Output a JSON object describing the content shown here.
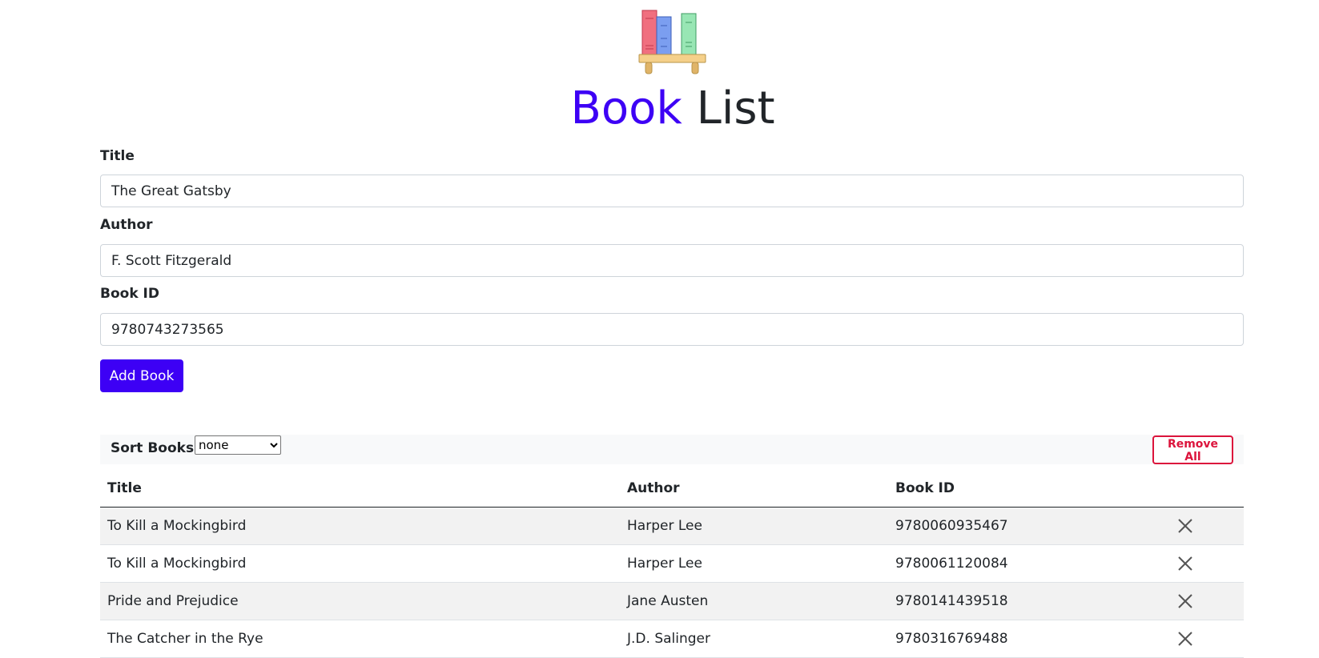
{
  "header": {
    "logo_icon": "bookshelf-icon",
    "title_accent": "Book",
    "title_rest": "List",
    "accent_color": "#3d00f5"
  },
  "form": {
    "title_label": "Title",
    "title_value": "The Great Gatsby",
    "author_label": "Author",
    "author_value": "F. Scott Fitzgerald",
    "bookid_label": "Book ID",
    "bookid_value": "9780743273565",
    "add_button": "Add Book"
  },
  "toolbar": {
    "sort_label": "Sort Books:",
    "sort_selected": "none",
    "remove_all": "Remove All",
    "remove_color": "#dc143c"
  },
  "table": {
    "headers": [
      "Title",
      "Author",
      "Book ID",
      ""
    ],
    "rows": [
      {
        "title": "To Kill a Mockingbird",
        "author": "Harper Lee",
        "book_id": "9780060935467",
        "action_icon": "close-icon"
      },
      {
        "title": "To Kill a Mockingbird",
        "author": "Harper Lee",
        "book_id": "9780061120084",
        "action_icon": "close-icon"
      },
      {
        "title": "Pride and Prejudice",
        "author": "Jane Austen",
        "book_id": "9780141439518",
        "action_icon": "close-icon"
      },
      {
        "title": "The Catcher in the Rye",
        "author": "J.D. Salinger",
        "book_id": "9780316769488",
        "action_icon": "close-icon"
      }
    ]
  }
}
